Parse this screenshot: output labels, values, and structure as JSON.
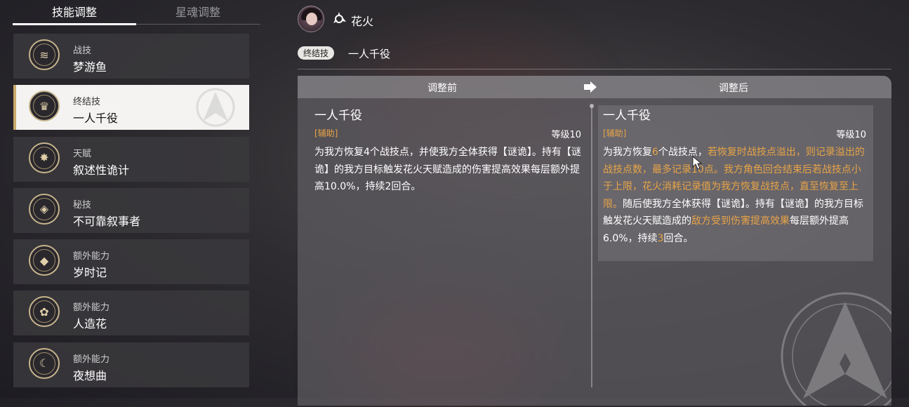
{
  "tabs": {
    "skill_adjust": "技能调整",
    "eidolon_adjust": "星魂调整"
  },
  "skills": [
    {
      "type": "战技",
      "name": "梦游鱼",
      "icon": "fish-icon"
    },
    {
      "type": "终结技",
      "name": "一人千役",
      "icon": "mask-icon"
    },
    {
      "type": "天赋",
      "name": "叙述性诡计",
      "icon": "star-burst-icon"
    },
    {
      "type": "秘技",
      "name": "不可靠叙事者",
      "icon": "fox-mask-icon"
    },
    {
      "type": "额外能力",
      "name": "岁时记",
      "icon": "lantern-icon"
    },
    {
      "type": "额外能力",
      "name": "人造花",
      "icon": "flower-icon"
    },
    {
      "type": "额外能力",
      "name": "夜想曲",
      "icon": "moon-fish-icon"
    }
  ],
  "header": {
    "character_name": "花火",
    "skill_badge": "终结技",
    "skill_name": "一人千役"
  },
  "compare": {
    "before_label": "调整前",
    "after_label": "调整后",
    "before": {
      "title": "一人千役",
      "tag": "[辅助]",
      "level": "等级10",
      "desc": "为我方恢复4个战技点，并使我方全体获得【谜诡】。持有【谜诡】的我方目标触发花火天赋造成的伤害提高效果每层额外提高10.0%，持续2回合。"
    },
    "after": {
      "title": "一人千役",
      "tag": "[辅助]",
      "level": "等级10",
      "desc": {
        "p1": "为我方恢复",
        "p2": "6",
        "p3": "个战技点，",
        "p4": "若恢复时战技点溢出，则记录溢出的战技点数，最多记录10点。我方角色回合结束后若战技点小于上限，花火消耗记录值为我方恢复战技点，直至恢复至上限。",
        "p5": "随后使我方全体获得【谜诡】。持有【谜诡】的我方目标触发花火天赋造成的",
        "p6": "敌方受到伤害提高效果",
        "p7": "每层额外提高6.0%，持续",
        "p8": "3",
        "p9": "回合。"
      }
    }
  },
  "colors": {
    "accent_gold": "#c9a86a",
    "highlight_orange": "#e8a446"
  }
}
